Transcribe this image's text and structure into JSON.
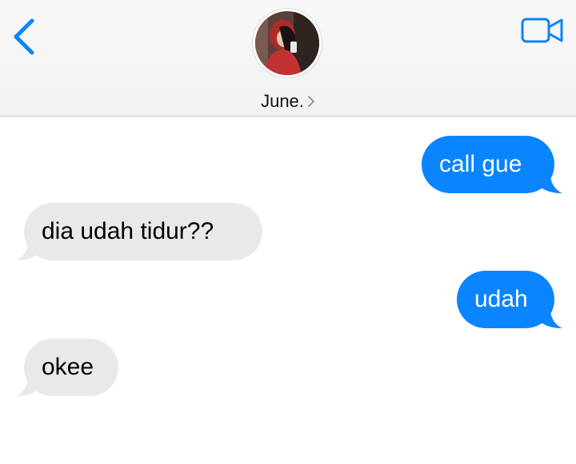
{
  "header": {
    "contact_name": "June.",
    "icons": {
      "back": "chevron-left-icon",
      "video": "video-camera-icon",
      "name_chevron": "chevron-right-icon"
    },
    "accent_color": "#0a84ff"
  },
  "messages": [
    {
      "direction": "sent",
      "text": "call gue"
    },
    {
      "direction": "received",
      "text": "dia udah tidur??"
    },
    {
      "direction": "sent",
      "text": "udah"
    },
    {
      "direction": "received",
      "text": "okee"
    }
  ],
  "colors": {
    "sent_bubble": "#0a84ff",
    "received_bubble": "#e9e9eb"
  }
}
